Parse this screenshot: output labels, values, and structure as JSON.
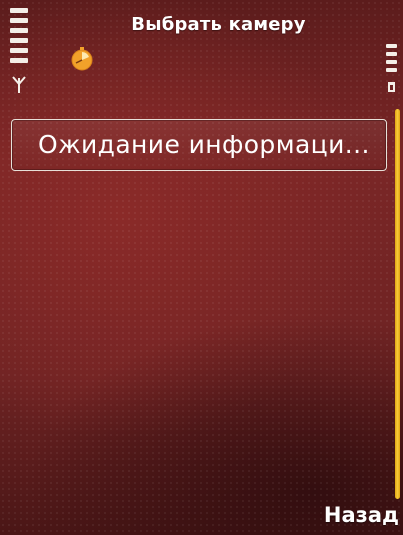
{
  "header": {
    "title": "Выбрать камеру"
  },
  "status": {
    "signal_icon": "signal-strength-icon",
    "battery_icon": "battery-icon",
    "clock_icon": "clock-icon"
  },
  "list": {
    "items": [
      {
        "label": "Ожидание информаци..."
      }
    ]
  },
  "softkeys": {
    "right_label": "Назад"
  },
  "colors": {
    "background": "#6e2323",
    "scrollbar": "#f2c22e",
    "text": "#ffffff"
  }
}
